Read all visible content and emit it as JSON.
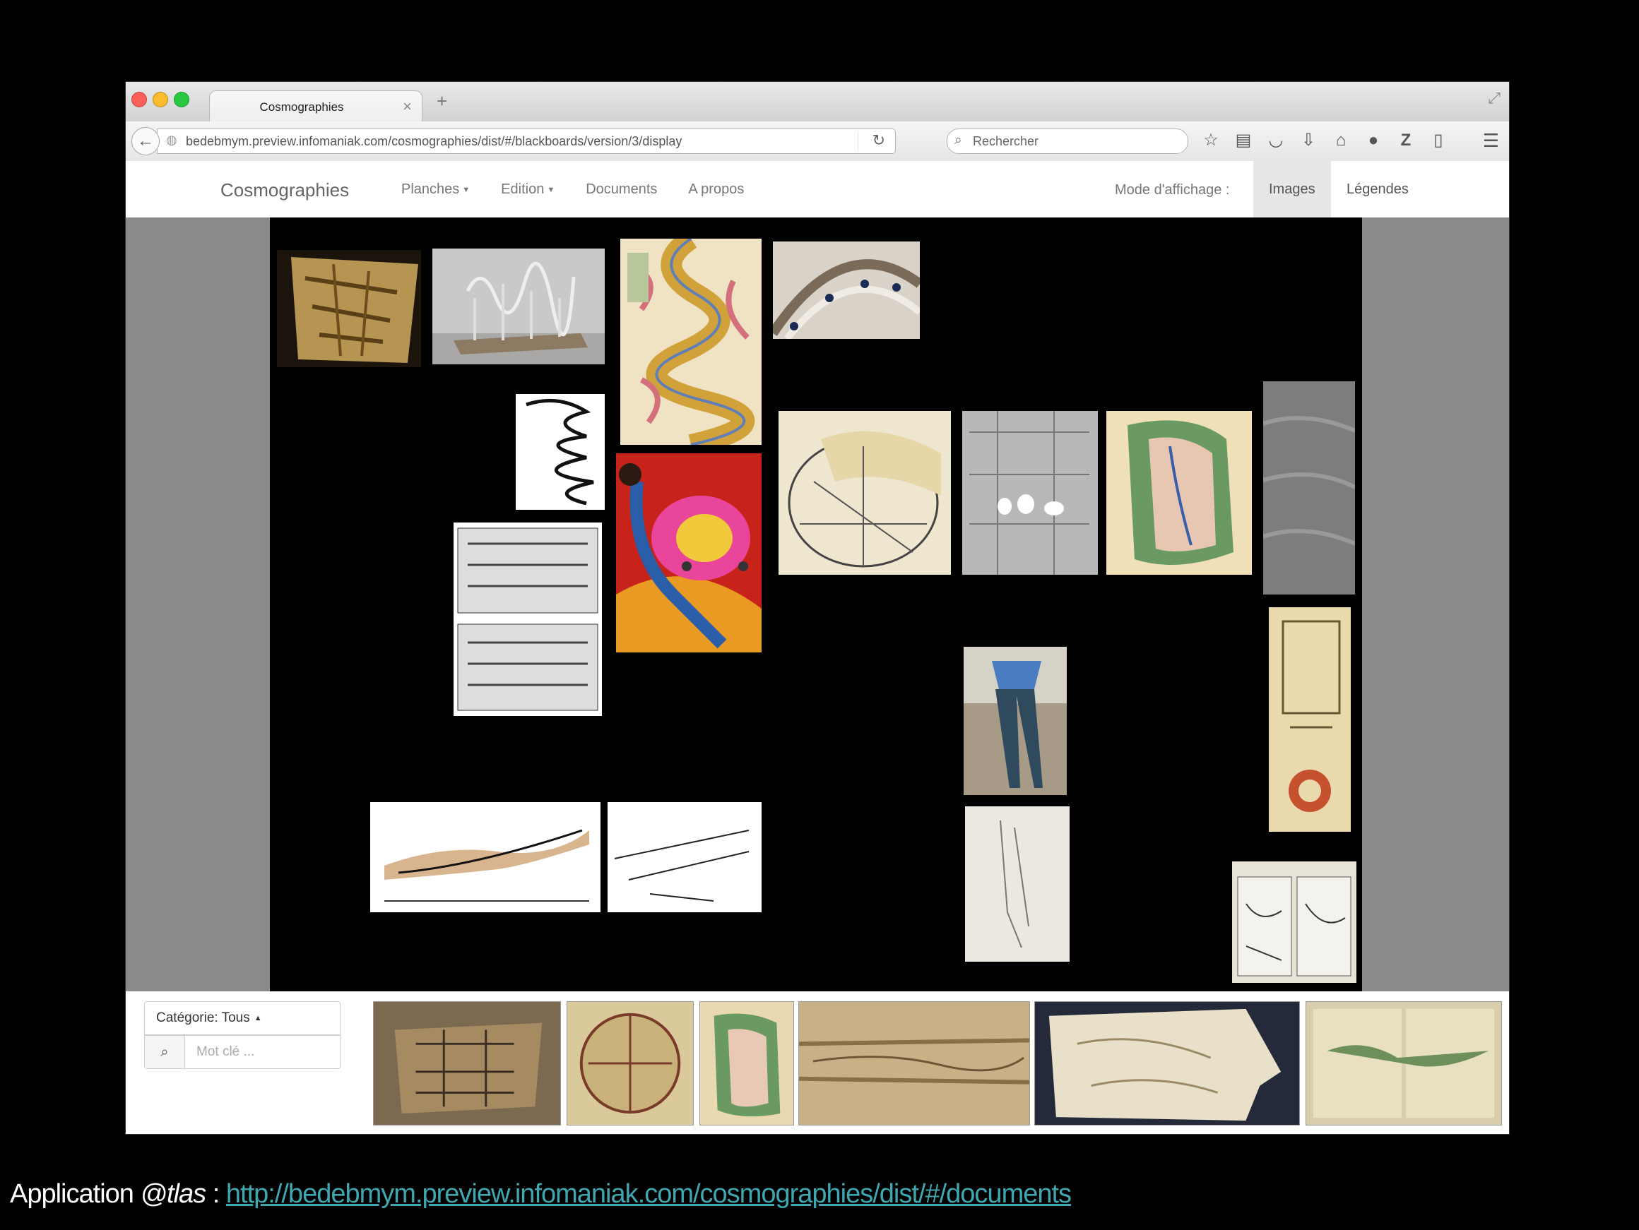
{
  "browser": {
    "tab_title": "Cosmographies",
    "tab_close": "×",
    "new_tab": "+",
    "url": "bedebmym.preview.infomaniak.com/cosmographies/dist/#/blackboards/version/3/display",
    "search_placeholder": "Rechercher",
    "toolbar_icons": [
      "star-icon",
      "clipboard-icon",
      "pocket-icon",
      "download-icon",
      "home-icon",
      "chat-icon",
      "zotero-icon",
      "page-menu-icon"
    ]
  },
  "app": {
    "brand": "Cosmographies",
    "menu": [
      {
        "label": "Planches",
        "dropdown": true
      },
      {
        "label": "Edition",
        "dropdown": true
      },
      {
        "label": "Documents",
        "dropdown": false
      },
      {
        "label": "A propos",
        "dropdown": false
      }
    ],
    "mode_label": "Mode d'affichage :",
    "mode_images": "Images",
    "mode_legendes": "Légendes",
    "active_mode": "Images"
  },
  "tray": {
    "category_label": "Catégorie: Tous",
    "keyword_placeholder": "Mot clé ..."
  },
  "caption": {
    "prefix": "Application ",
    "name": "@tlas",
    "separator": " : ",
    "link": "http://bedebmym.preview.infomaniak.com/cosmographies/dist/#/documents"
  },
  "colors": {
    "board": "#000000",
    "stage": "#8a8a8a",
    "link": "#3fa7b0",
    "active_mode_bg": "#e7e7e7"
  }
}
